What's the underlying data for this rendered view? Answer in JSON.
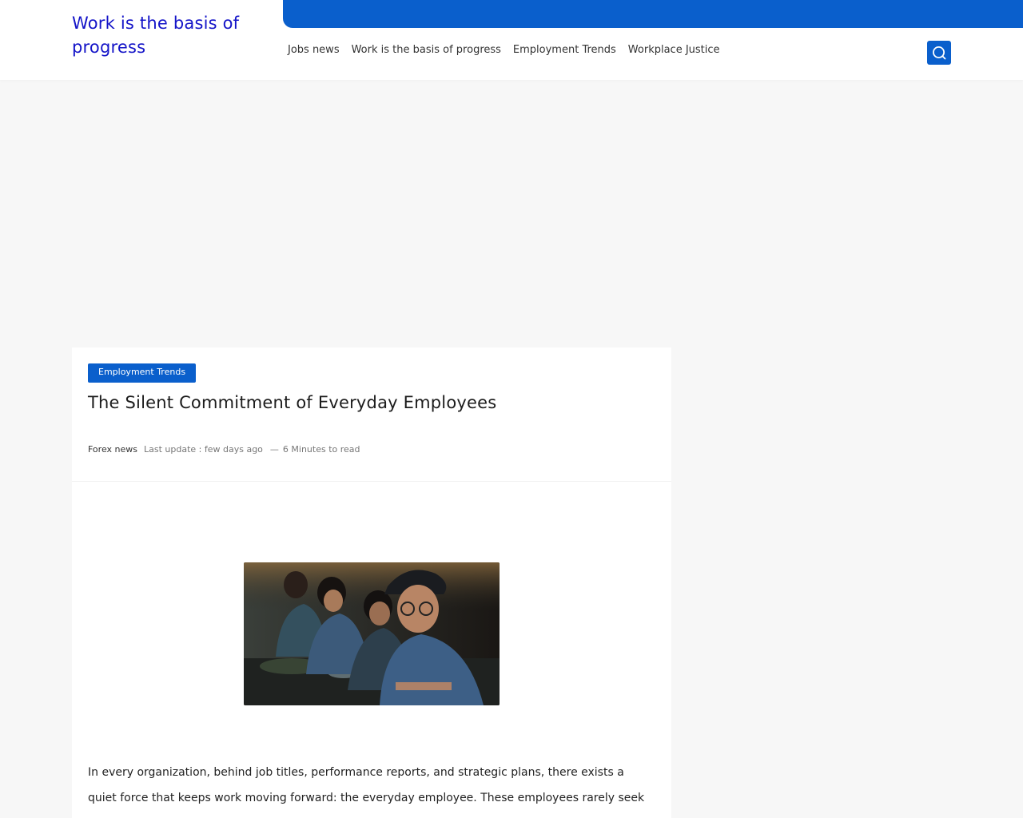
{
  "site": {
    "title": "Work is the basis of progress"
  },
  "nav": {
    "items": [
      {
        "label": "Jobs news"
      },
      {
        "label": "Work is the basis of progress"
      },
      {
        "label": "Employment Trends"
      },
      {
        "label": "Workplace Justice"
      }
    ]
  },
  "search": {
    "icon": "search-icon"
  },
  "article": {
    "category": "Employment Trends",
    "title": "The Silent Commitment of Everyday Employees",
    "author": "Forex news",
    "last_update": "Last update : few days ago",
    "read_time": "6 Minutes to read",
    "intro": "In every organization, behind job titles, performance reports, and strategic plans, there exists a quiet force that keeps work moving forward: the everyday employee. These employees rarely seek"
  },
  "colors": {
    "brand_blue": "#0a5fcc",
    "site_title": "#1414c8",
    "page_bg": "#f7f7f7"
  }
}
